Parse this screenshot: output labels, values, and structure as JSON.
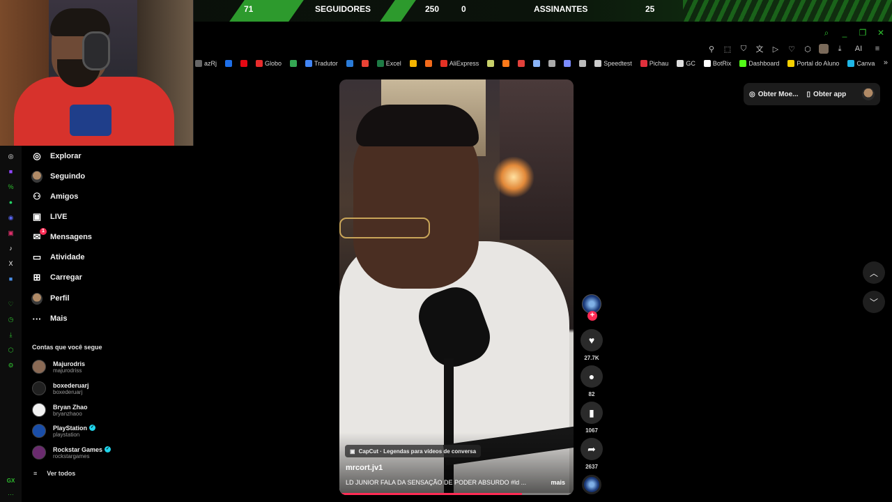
{
  "stream_overlay": {
    "followers_left_value": "71",
    "followers_label": "SEGUIDORES",
    "followers_right_value": "250",
    "subscribers_left_value": "0",
    "subscribers_label": "ASSINANTES",
    "subscribers_right_value": "25",
    "accent_color": "#2d9a2d"
  },
  "window_controls": [
    "search-icon",
    "minimize-icon",
    "restore-icon",
    "close-icon"
  ],
  "extensions": {
    "ai_label": "AI"
  },
  "bookmarks": [
    {
      "label": "azRj",
      "icon": "bookmark-icon",
      "color": "#666"
    },
    {
      "label": "",
      "icon": "circle-blue-icon",
      "color": "#1e6fe8"
    },
    {
      "label": "",
      "icon": "netflix-icon",
      "color": "#e50914"
    },
    {
      "label": "Globo",
      "icon": "globo-icon",
      "color": "#e82c2c"
    },
    {
      "label": "",
      "icon": "maps-icon",
      "color": "#34a853"
    },
    {
      "label": "Tradutor",
      "icon": "translate-icon",
      "color": "#4285f4"
    },
    {
      "label": "",
      "icon": "cube-icon",
      "color": "#2a7bd8"
    },
    {
      "label": "",
      "icon": "gmail-icon",
      "color": "#ea4335"
    },
    {
      "label": "Excel",
      "icon": "excel-icon",
      "color": "#1d7a44"
    },
    {
      "label": "",
      "icon": "drive-icon",
      "color": "#f4b400"
    },
    {
      "label": "",
      "icon": "orange-square-icon",
      "color": "#f26a1b"
    },
    {
      "label": "AliExpress",
      "icon": "aliexpress-icon",
      "color": "#e43225"
    },
    {
      "label": "",
      "icon": "oval-icon",
      "color": "#c8d06a"
    },
    {
      "label": "",
      "icon": "orange-icon",
      "color": "#ff7a1a"
    },
    {
      "label": "",
      "icon": "shop-icon",
      "color": "#e2413b"
    },
    {
      "label": "",
      "icon": "sparkle-icon",
      "color": "#8ab4f8"
    },
    {
      "label": "",
      "icon": "grid-icon",
      "color": "#aaaaaa"
    },
    {
      "label": "",
      "icon": "link-icon",
      "color": "#7b8cff"
    },
    {
      "label": "",
      "icon": "square-icon",
      "color": "#bbbbbb"
    },
    {
      "label": "Speedtest",
      "icon": "speedtest-icon",
      "color": "#cccccc"
    },
    {
      "label": "Pichau",
      "icon": "pichau-icon",
      "color": "#e0303c"
    },
    {
      "label": "GC",
      "icon": "gc-icon",
      "color": "#dddddd"
    },
    {
      "label": "BotRix",
      "icon": "botrix-icon",
      "color": "#ffffff"
    },
    {
      "label": "Dashboard",
      "icon": "kick-icon",
      "color": "#53fc18"
    },
    {
      "label": "Portal do Aluno",
      "icon": "portal-icon",
      "color": "#f5d000"
    },
    {
      "label": "Canva",
      "icon": "canva-icon",
      "color": "#1fb6e6"
    }
  ],
  "rail_icons": [
    {
      "name": "chatgpt-icon",
      "color": "#ffffff",
      "glyph": "◎"
    },
    {
      "name": "twitch-icon",
      "color": "#9146ff",
      "glyph": "■"
    },
    {
      "name": "percent-icon",
      "color": "#2fbf2f",
      "glyph": "%"
    },
    {
      "name": "whatsapp-icon",
      "color": "#25d366",
      "glyph": "●"
    },
    {
      "name": "discord-icon",
      "color": "#5865f2",
      "glyph": "◉"
    },
    {
      "name": "instagram-icon",
      "color": "#e1306c",
      "glyph": "▣"
    },
    {
      "name": "tiktok-icon",
      "color": "#ffffff",
      "glyph": "♪"
    },
    {
      "name": "x-icon",
      "color": "#ffffff",
      "glyph": "X"
    },
    {
      "name": "app-icon",
      "color": "#4a8fe7",
      "glyph": "■"
    },
    {
      "name": "heart-icon",
      "color": "#2fbf2f",
      "glyph": "♡"
    },
    {
      "name": "history-icon",
      "color": "#2fbf2f",
      "glyph": "◷"
    },
    {
      "name": "download-icon",
      "color": "#2fbf2f",
      "glyph": "⤓"
    },
    {
      "name": "puzzle-icon",
      "color": "#2fbf2f",
      "glyph": "⬡"
    },
    {
      "name": "settings-icon",
      "color": "#2fbf2f",
      "glyph": "⚙"
    }
  ],
  "rail_bottom_label": "GX",
  "rail_more_label": "···",
  "nav": [
    {
      "label": "Explorar",
      "icon": "compass-icon",
      "glyph": "◎"
    },
    {
      "label": "Seguindo",
      "icon": "following-avatar-icon",
      "glyph": ""
    },
    {
      "label": "Amigos",
      "icon": "friends-icon",
      "glyph": "⚇"
    },
    {
      "label": "LIVE",
      "icon": "live-icon",
      "glyph": "▣"
    },
    {
      "label": "Mensagens",
      "icon": "messages-icon",
      "glyph": "✉",
      "badge": "1"
    },
    {
      "label": "Atividade",
      "icon": "activity-icon",
      "glyph": "▭"
    },
    {
      "label": "Carregar",
      "icon": "upload-icon",
      "glyph": "⊞"
    },
    {
      "label": "Perfil",
      "icon": "profile-avatar-icon",
      "glyph": ""
    },
    {
      "label": "Mais",
      "icon": "more-icon",
      "glyph": "···"
    }
  ],
  "following_section_title": "Contas que você segue",
  "following": [
    {
      "name": "Majurodris",
      "handle": "majurodriss",
      "verified": false,
      "color": "#8a6a55"
    },
    {
      "name": "boxederuarj",
      "handle": "boxederuarj",
      "verified": false,
      "color": "#202020"
    },
    {
      "name": "Bryan Zhao",
      "handle": "bryanzhaoo",
      "verified": false,
      "color": "#f2f2f2"
    },
    {
      "name": "PlayStation",
      "handle": "playstation",
      "verified": true,
      "color": "#1a4ea8"
    },
    {
      "name": "Rockstar Games",
      "handle": "rockstargames",
      "verified": true,
      "color": "#6a2b6e"
    }
  ],
  "see_all_label": "Ver todos",
  "top_right": {
    "coins_label": "Obter Moe...",
    "app_label": "Obter app"
  },
  "video": {
    "capcut_label": "CapCut · Legendas para vídeos de conversa",
    "author": "mrcort.jv1",
    "caption": "LD JUNIOR FALA DA SENSAÇÃO DE PODER ABSURDO #ld ...",
    "more_label": "mais",
    "progress_fraction": 0.78
  },
  "actions": {
    "likes": "27.7K",
    "comments": "82",
    "saves": "1067",
    "shares": "2637"
  }
}
